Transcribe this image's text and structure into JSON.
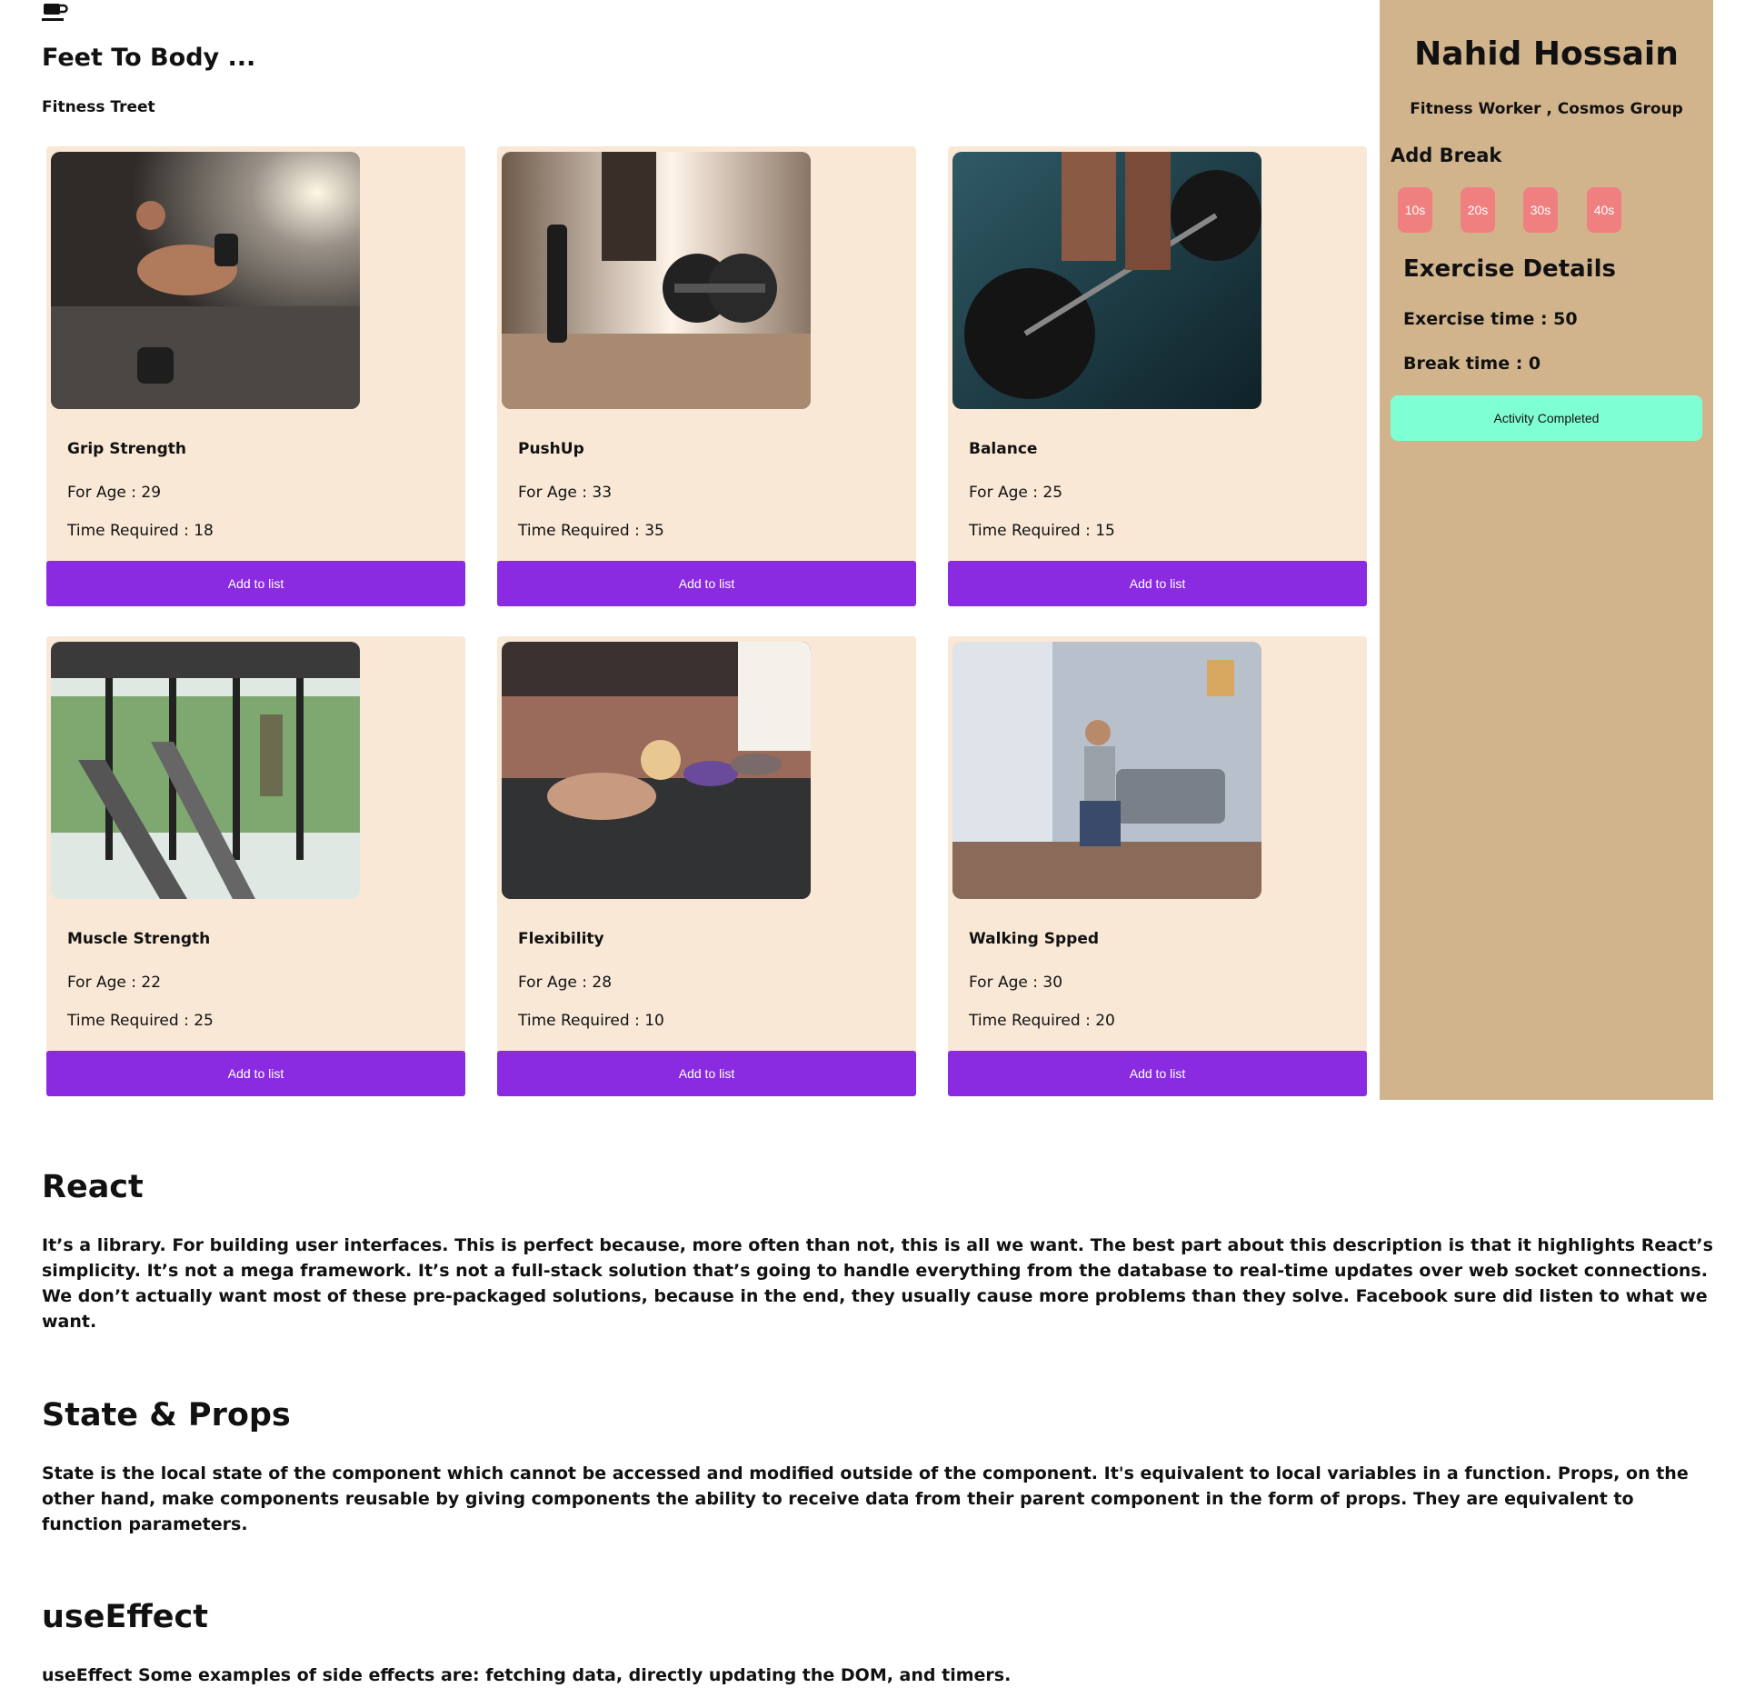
{
  "header": {
    "logo_icon": "coffee-cup-icon",
    "title": "Feet To Body ...",
    "subtitle": "Fitness Treet"
  },
  "exercises": [
    {
      "name": "Grip Strength",
      "age": "For Age : 29",
      "time": "Time Required : 18",
      "button": "Add to list",
      "image": "man-dumbbell-plank-photo"
    },
    {
      "name": "PushUp",
      "age": "For Age : 33",
      "time": "Time Required : 35",
      "button": "Add to list",
      "image": "dumbbells-floor-photo"
    },
    {
      "name": "Balance",
      "age": "For Age : 25",
      "time": "Time Required : 15",
      "button": "Add to list",
      "image": "barbell-deadlift-photo"
    },
    {
      "name": "Muscle Strength",
      "age": "For Age : 22",
      "time": "Time Required : 25",
      "button": "Add to list",
      "image": "treadmill-gym-photo"
    },
    {
      "name": "Flexibility",
      "age": "For Age : 28",
      "time": "Time Required : 10",
      "button": "Add to list",
      "image": "group-pushup-photo"
    },
    {
      "name": "Walking Spped",
      "age": "For Age : 30",
      "time": "Time Required : 20",
      "button": "Add to list",
      "image": "home-lunge-photo"
    }
  ],
  "sidebar": {
    "name": "Nahid Hossain",
    "role": "Fitness Worker , Cosmos Group",
    "add_break_heading": "Add Break",
    "break_options": [
      "10s",
      "20s",
      "30s",
      "40s"
    ],
    "details_heading": "Exercise Details",
    "exercise_time": "Exercise time : 50",
    "break_time": "Break time : 0",
    "complete_button": "Activity Completed"
  },
  "qa": [
    {
      "title": "React",
      "body": "It’s a library. For building user interfaces. This is perfect because, more often than not, this is all we want. The best part about this description is that it highlights React’s simplicity. It’s not a mega framework. It’s not a full-stack solution that’s going to handle everything from the database to real-time updates over web socket connections. We don’t actually want most of these pre-packaged solutions, because in the end, they usually cause more problems than they solve. Facebook sure did listen to what we want."
    },
    {
      "title": "State & Props",
      "body": "State is the local state of the component which cannot be accessed and modified outside of the component. It's equivalent to local variables in a function. Props, on the other hand, make components reusable by giving components the ability to receive data from their parent component in the form of props. They are equivalent to function parameters."
    },
    {
      "title": "useEffect",
      "body": "useEffect Some examples of side effects are: fetching data, directly updating the DOM, and timers."
    }
  ],
  "colors": {
    "card_bg": "#f9e8d6",
    "add_button": "#8a2be2",
    "sidebar_bg": "#d2b48c",
    "break_button": "#f08080",
    "complete_button": "#7fffd4"
  }
}
